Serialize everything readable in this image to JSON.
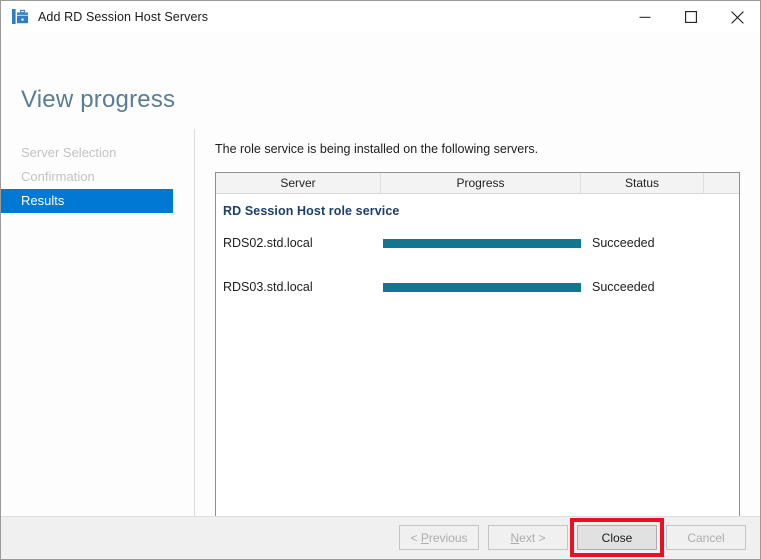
{
  "window": {
    "title": "Add RD Session Host Servers",
    "icon": "rd-session-host-icon",
    "controls": {
      "minimize": "minimize-button",
      "maximize": "maximize-button",
      "close": "close-button"
    }
  },
  "page": {
    "title": "View progress"
  },
  "nav": {
    "items": [
      {
        "label": "Server Selection",
        "state": "disabled"
      },
      {
        "label": "Confirmation",
        "state": "disabled"
      },
      {
        "label": "Results",
        "state": "selected"
      }
    ]
  },
  "main": {
    "intro": "The role service is being installed on the following servers.",
    "table": {
      "columns": [
        "Server",
        "Progress",
        "Status",
        ""
      ],
      "group_label": "RD Session Host role service",
      "rows": [
        {
          "server": "RDS02.std.local",
          "progress": 100,
          "status": "Succeeded"
        },
        {
          "server": "RDS03.std.local",
          "progress": 100,
          "status": "Succeeded"
        }
      ]
    }
  },
  "footer": {
    "buttons": [
      {
        "label_pre": "< ",
        "label_key": "P",
        "label_post": "revious",
        "enabled": false
      },
      {
        "label_pre": "",
        "label_key": "N",
        "label_post": "ext >",
        "enabled": false
      },
      {
        "label_pre": "",
        "label_key": "",
        "label_post": "Close",
        "enabled": true,
        "highlighted": true
      },
      {
        "label_pre": "",
        "label_key": "",
        "label_post": "Cancel",
        "enabled": false
      }
    ]
  },
  "colors": {
    "accent_blue": "#0078d4",
    "progress_teal": "#12768f",
    "heading_blue": "#5a7d94",
    "group_blue": "#1c3f6e",
    "annotation_red": "#e81123"
  }
}
